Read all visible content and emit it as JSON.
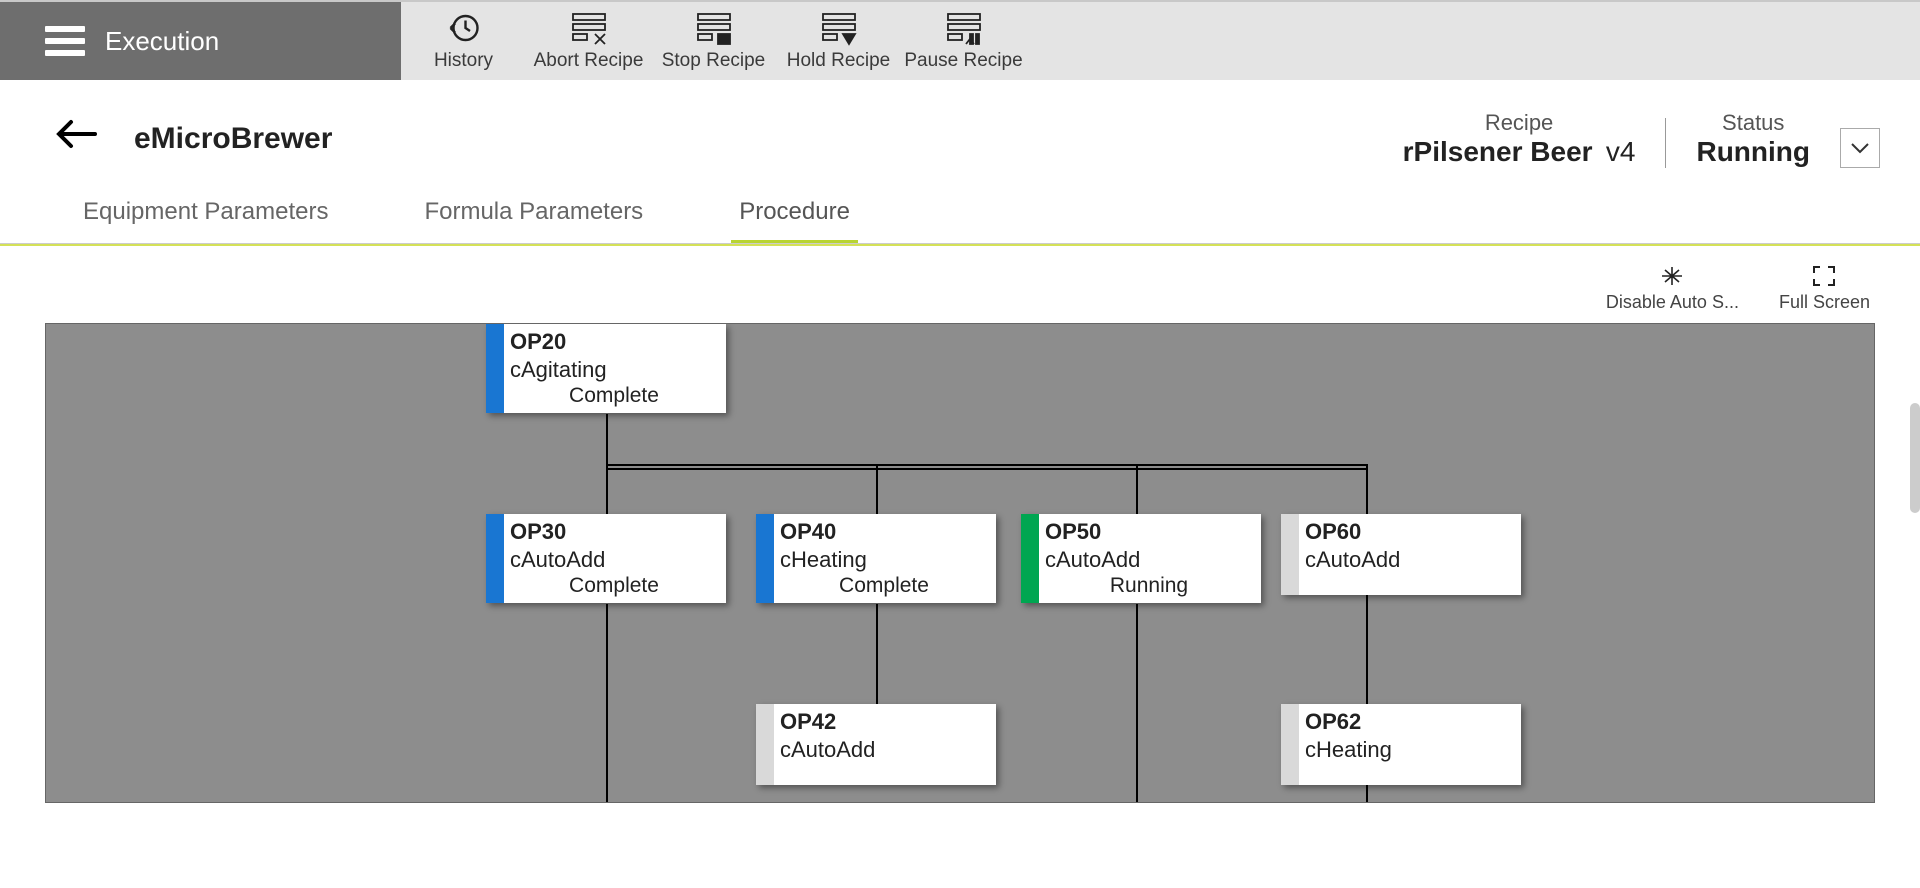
{
  "topbar": {
    "execution": "Execution",
    "buttons": [
      {
        "label": "History"
      },
      {
        "label": "Abort Recipe"
      },
      {
        "label": "Stop Recipe"
      },
      {
        "label": "Hold Recipe"
      },
      {
        "label": "Pause Recipe"
      }
    ]
  },
  "header": {
    "app_title": "eMicroBrewer",
    "recipe_label": "Recipe",
    "recipe_name": "rPilsener Beer",
    "recipe_version": "v4",
    "status_label": "Status",
    "status_value": "Running"
  },
  "tabs": [
    {
      "label": "Equipment Parameters",
      "active": false
    },
    {
      "label": "Formula Parameters",
      "active": false
    },
    {
      "label": "Procedure",
      "active": true
    }
  ],
  "canvas_tools": {
    "disable_auto": "Disable Auto S...",
    "full_screen": "Full Screen"
  },
  "ops": {
    "op20": {
      "name": "OP20",
      "type": "cAgitating",
      "status": "Complete",
      "stripe": "blue"
    },
    "op30": {
      "name": "OP30",
      "type": "cAutoAdd",
      "status": "Complete",
      "stripe": "blue"
    },
    "op40": {
      "name": "OP40",
      "type": "cHeating",
      "status": "Complete",
      "stripe": "blue"
    },
    "op50": {
      "name": "OP50",
      "type": "cAutoAdd",
      "status": "Running",
      "stripe": "green"
    },
    "op60": {
      "name": "OP60",
      "type": "cAutoAdd",
      "status": "",
      "stripe": "grey"
    },
    "op42": {
      "name": "OP42",
      "type": "cAutoAdd",
      "status": "",
      "stripe": "grey"
    },
    "op62": {
      "name": "OP62",
      "type": "cHeating",
      "status": "",
      "stripe": "grey"
    }
  }
}
